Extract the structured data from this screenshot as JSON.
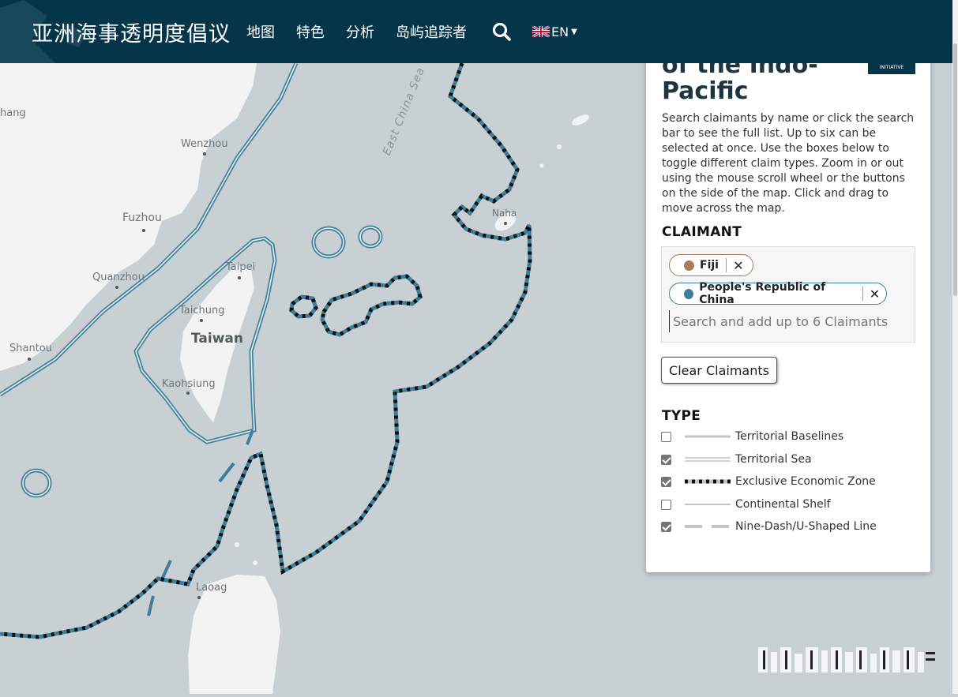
{
  "header": {
    "brand": "亚洲海事透明度倡议",
    "nav": [
      "地图",
      "特色",
      "分析",
      "岛屿追踪者"
    ],
    "search_icon": "search-icon",
    "language": "EN"
  },
  "map": {
    "labels": {
      "wenzhou": "Wenzhou",
      "fuzhou": "Fuzhou",
      "quanzhou": "Quanzhou",
      "shantou": "Shantou",
      "taipei": "Taipei",
      "taichung": "Taichung",
      "taiwan": "Taiwan",
      "kaohsiung": "Kaohsiung",
      "naha": "Naha",
      "laoag": "Laoag",
      "hang": "hang",
      "east_china_sea": "East China Sea"
    },
    "colors": {
      "land": "#f3f3f3",
      "sea": "#c8d0d4",
      "claim_line": "#3d7f9a",
      "eez_dash": "#111111"
    }
  },
  "panel": {
    "title": "of the Indo-Pacific",
    "badge": "INITIATIVE",
    "description": "Search claimants by name or click the search bar to see the full list. Up to six can be selected at once. Use the boxes below to toggle different claim types. Zoom in or out using the mouse scroll wheel or the buttons on the side of the map. Click and drag to move across the map.",
    "claimant_heading": "CLAIMANT",
    "claimants": [
      {
        "name": "Fiji",
        "color": "#a67c5b"
      },
      {
        "name": "People's Republic of China",
        "color": "#3d7f9a"
      }
    ],
    "search_placeholder": "Search and add up to 6 Claimants",
    "clear_button": "Clear Claimants",
    "type_heading": "TYPE",
    "types": [
      {
        "label": "Territorial Baselines",
        "checked": false
      },
      {
        "label": "Territorial Sea",
        "checked": true
      },
      {
        "label": "Exclusive Economic Zone",
        "checked": true
      },
      {
        "label": "Continental Shelf",
        "checked": false
      },
      {
        "label": "Nine-Dash/U-Shaped Line",
        "checked": true
      }
    ]
  }
}
